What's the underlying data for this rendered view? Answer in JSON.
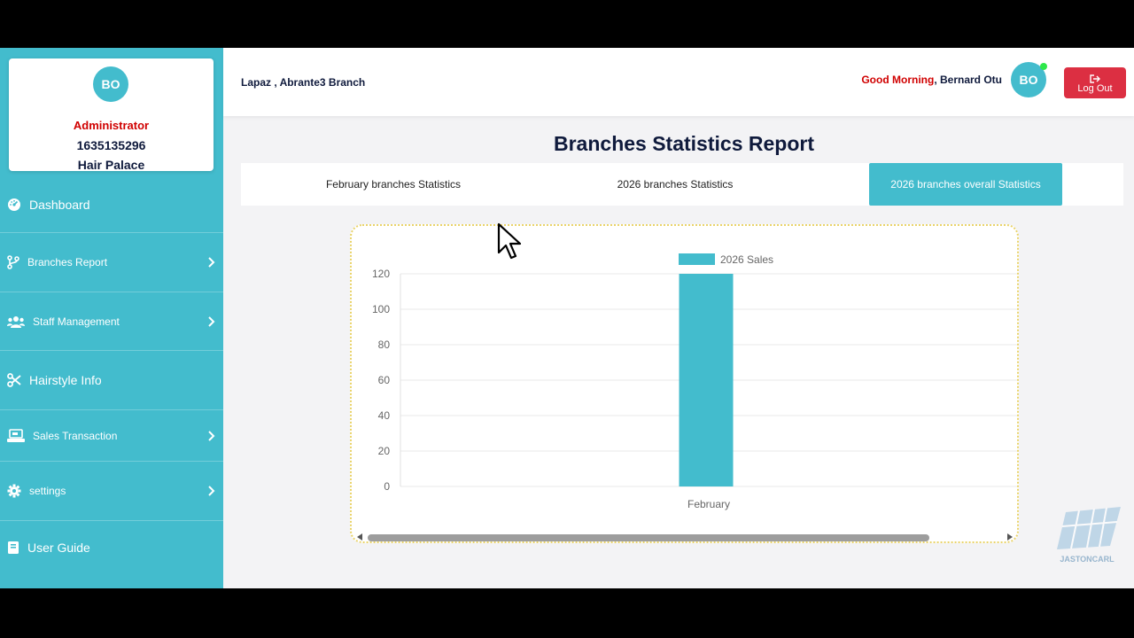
{
  "profile": {
    "initials": "BO",
    "role": "Administrator",
    "phone": "1635135296",
    "shop": "Hair Palace"
  },
  "sidebar": {
    "items": [
      {
        "label": "Dashboard",
        "icon": "dashboard-icon"
      },
      {
        "label": "Branches Report",
        "icon": "branch-icon",
        "has_submenu": true
      },
      {
        "label": "Staff Management",
        "icon": "users-icon",
        "has_submenu": true
      },
      {
        "label": "Hairstyle Info",
        "icon": "scissors-icon"
      },
      {
        "label": "Sales Transaction",
        "icon": "cash-register-icon",
        "has_submenu": true
      },
      {
        "label": "settings",
        "icon": "gear-icon",
        "has_submenu": true
      },
      {
        "label": "User Guide",
        "icon": "book-icon"
      }
    ]
  },
  "topbar": {
    "branch": "Lapaz , Abrante3 Branch",
    "greeting_prefix": "Good Morning",
    "greeting_sep": ", ",
    "user_name": "Bernard Otu",
    "avatar_initials": "BO",
    "logout_label": "Log Out"
  },
  "page": {
    "title": "Branches Statistics Report",
    "tabs": [
      {
        "label": "February branches Statistics",
        "active": false
      },
      {
        "label": "2026 branches Statistics",
        "active": false
      },
      {
        "label": "2026 branches overall Statistics",
        "active": true
      }
    ]
  },
  "watermark": {
    "text": "JASTONCARL"
  },
  "colors": {
    "accent": "#43bccd",
    "danger": "#dc2f42",
    "navy": "#0f1a3c",
    "red_text": "#d00000"
  },
  "chart_data": {
    "type": "bar",
    "categories": [
      "February"
    ],
    "series": [
      {
        "name": "2026 Sales",
        "values": [
          120
        ]
      }
    ],
    "ylim": [
      0,
      120
    ],
    "yticks": [
      0,
      20,
      40,
      60,
      80,
      100,
      120
    ],
    "legend": "top",
    "grid": true,
    "color": "#43bccd"
  }
}
